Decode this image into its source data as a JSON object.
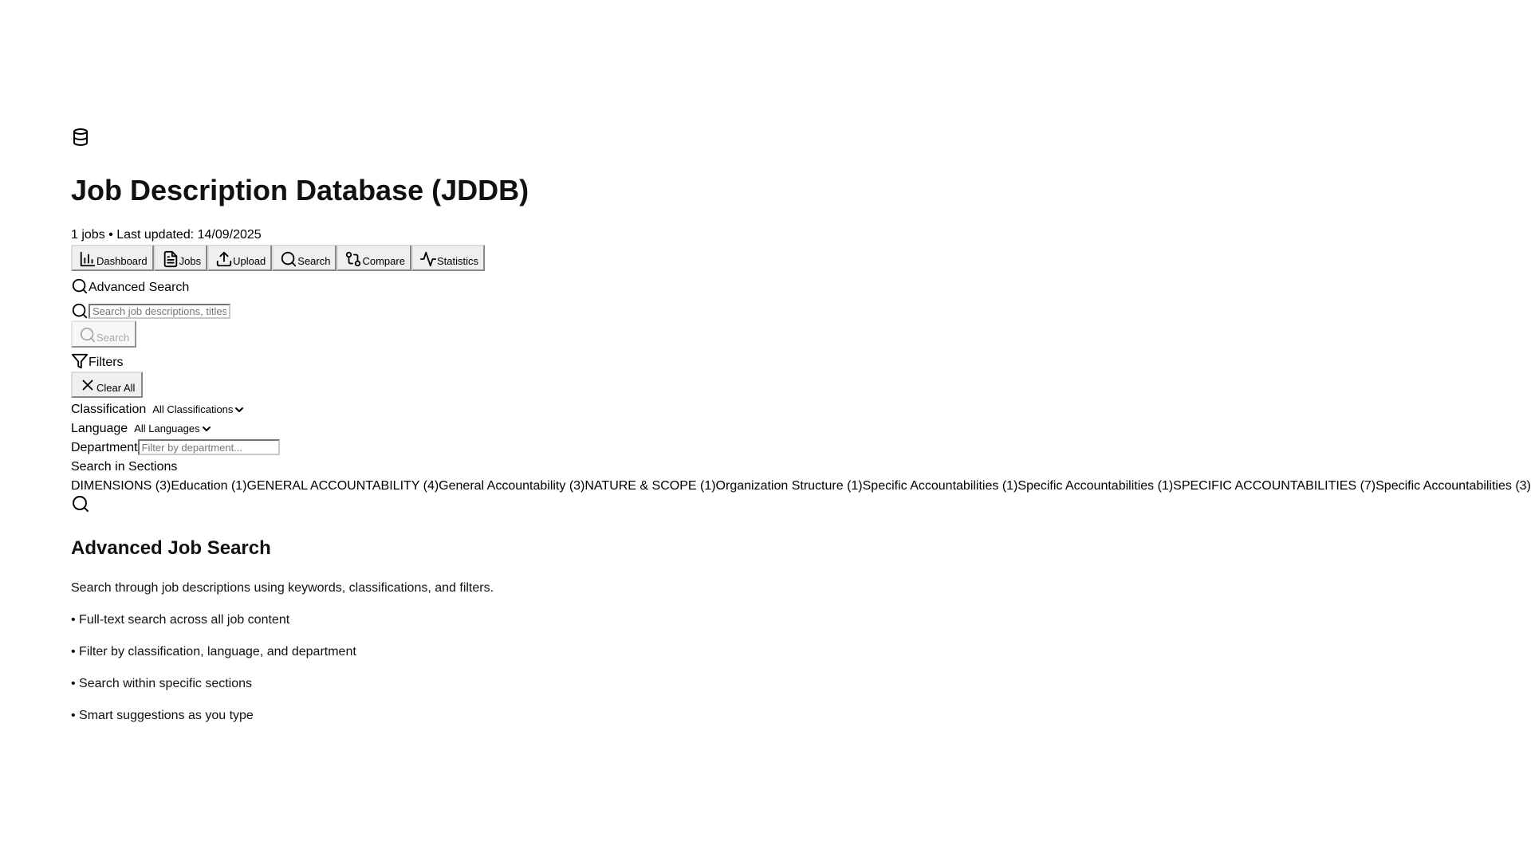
{
  "header": {
    "app_icon": "database-icon",
    "title": "Job Description Database (JDDB)",
    "subtitle": "1 jobs • Last updated: 14/09/2025"
  },
  "nav": {
    "items": [
      {
        "label": "Dashboard",
        "icon": "bar-chart-icon"
      },
      {
        "label": "Jobs",
        "icon": "document-icon"
      },
      {
        "label": "Upload",
        "icon": "upload-icon"
      },
      {
        "label": "Search",
        "icon": "search-icon"
      },
      {
        "label": "Compare",
        "icon": "compare-icon"
      },
      {
        "label": "Statistics",
        "icon": "activity-icon"
      }
    ]
  },
  "search_panel": {
    "title": "Advanced Search",
    "input_placeholder": "Search job descriptions, titles",
    "search_button": "Search"
  },
  "filters": {
    "title": "Filters",
    "clear_all": "Clear All",
    "classification_label": "Classification",
    "classification_selected": "All Classifications",
    "language_label": "Language",
    "language_selected": "All Languages",
    "department_label": "Department",
    "department_placeholder": "Filter by department...",
    "sections_label": "Search in Sections",
    "sections": [
      "DIMENSIONS (3)",
      "Education (1)",
      "GENERAL ACCOUNTABILITY (4)",
      "General Accountability (3)",
      "NATURE & SCOPE (1)",
      "Organization Structure (1)",
      "Specific Accountabilities (1)",
      "Specific Accountabilities (1)",
      "SPECIFIC ACCOUNTABILITIES (7)",
      "Specific Accountabilities (3)"
    ]
  },
  "info": {
    "heading": "Advanced Job Search",
    "intro": "Search through job descriptions using keywords, classifications, and filters.",
    "features": [
      "• Full-text search across all job content",
      "• Filter by classification, language, and department",
      "• Search within specific sections",
      "• Smart suggestions as you type"
    ]
  }
}
